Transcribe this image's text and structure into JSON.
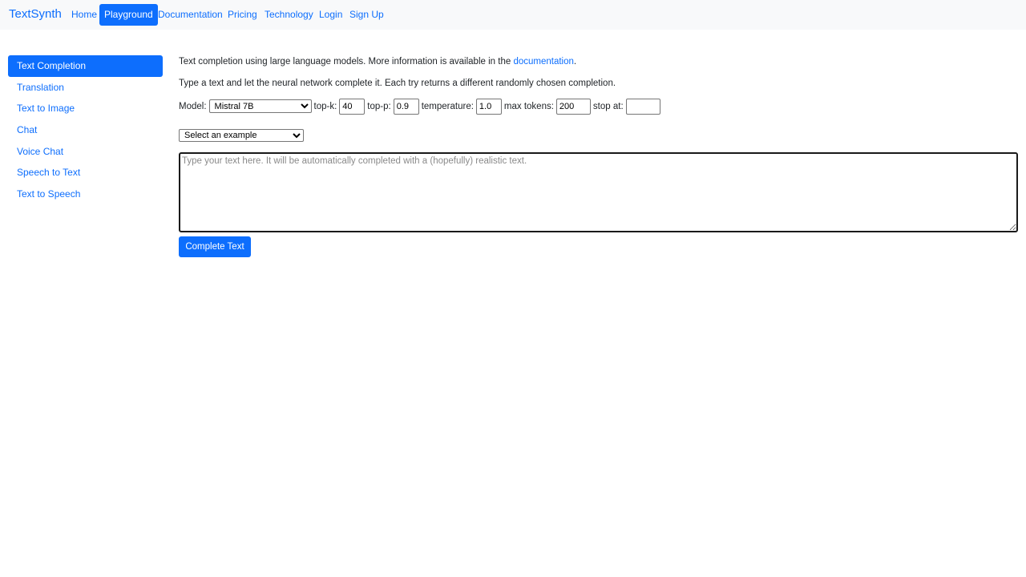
{
  "navbar": {
    "brand": "TextSynth",
    "links": [
      {
        "label": "Home",
        "active": false
      },
      {
        "label": "Playground",
        "active": true
      },
      {
        "label": "Documentation",
        "active": false
      },
      {
        "label": "Pricing",
        "active": false
      },
      {
        "label": "Technology",
        "active": false
      },
      {
        "label": "Login",
        "active": false
      },
      {
        "label": "Sign Up",
        "active": false
      }
    ]
  },
  "sidebar": {
    "items": [
      {
        "label": "Text Completion",
        "active": true
      },
      {
        "label": "Translation",
        "active": false
      },
      {
        "label": "Text to Image",
        "active": false
      },
      {
        "label": "Chat",
        "active": false
      },
      {
        "label": "Voice Chat",
        "active": false
      },
      {
        "label": "Speech to Text",
        "active": false
      },
      {
        "label": "Text to Speech",
        "active": false
      }
    ]
  },
  "main": {
    "intro_text": "Text completion using large language models. More information is available in the ",
    "intro_link": "documentation",
    "intro_end": ".",
    "instructions": "Type a text and let the neural network complete it. Each try returns a different randomly chosen completion.",
    "controls": {
      "model_label": "Model:",
      "model_value": "Mistral 7B",
      "topk_label": "top-k:",
      "topk_value": "40",
      "topp_label": "top-p:",
      "topp_value": "0.9",
      "temperature_label": "temperature:",
      "temperature_value": "1.0",
      "max_tokens_label": "max tokens:",
      "max_tokens_value": "200",
      "stop_label": "stop at:",
      "stop_value": ""
    },
    "example_select": "Select an example",
    "prompt_placeholder": "Type your text here. It will be automatically completed with a (hopefully) realistic text.",
    "complete_button": "Complete Text"
  },
  "colors": {
    "accent": "#0d6efd",
    "navbar_bg": "#f8f9fa",
    "text": "#212529"
  }
}
